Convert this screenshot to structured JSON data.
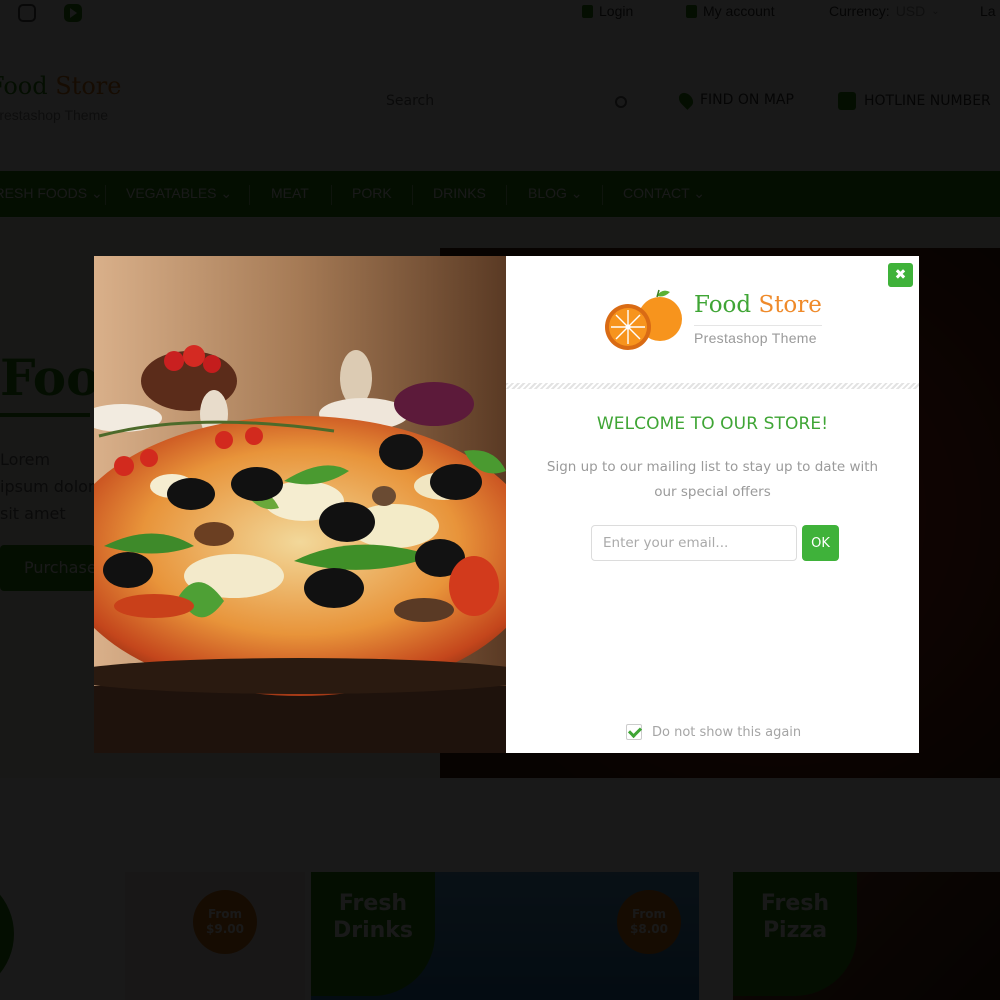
{
  "topbar": {
    "social": [
      "instagram-icon",
      "youtube-icon"
    ],
    "login": "Login",
    "my_account": "My account",
    "currency_label": "Currency:",
    "currency_value": "USD",
    "language_partial": "La"
  },
  "header": {
    "logo_title_part1": "Food ",
    "logo_title_part2": "Store",
    "logo_subtitle": "Prestashop Theme",
    "search_placeholder": "Search",
    "location_text": "FIND ON MAP",
    "phone_text": "HOTLINE NUMBER"
  },
  "nav": {
    "items": [
      {
        "label": "Fresh Foods",
        "dropdown": true
      },
      {
        "label": "Vegatables",
        "dropdown": true
      },
      {
        "label": "Meat",
        "dropdown": false
      },
      {
        "label": "Pork",
        "dropdown": false
      },
      {
        "label": "Drinks",
        "dropdown": false
      },
      {
        "label": "Blog",
        "dropdown": true
      },
      {
        "label": "Contact",
        "dropdown": true
      }
    ]
  },
  "hero": {
    "title": "Food",
    "text": "Lorem ipsum dolor sit amet elit. Integer curabitur",
    "button": "Purchase"
  },
  "cards": [
    {
      "title": "",
      "price_label": ""
    },
    {
      "title": "",
      "price_from": "From",
      "price": "$9.00"
    },
    {
      "title_line1": "Fresh",
      "title_line2": "Drinks",
      "price_from": "From",
      "price": "$8.00"
    },
    {
      "title_line1": "Fresh",
      "title_line2": "Pizza"
    }
  ],
  "modal": {
    "logo_title_part1": "Food ",
    "logo_title_part2": "Store",
    "logo_subtitle": "Prestashop Theme",
    "heading": "WELCOME TO OUR STORE!",
    "description": "Sign up to our mailing list to stay up to date with our special offers",
    "email_value": "",
    "email_placeholder": "Enter your email...",
    "ok_label": "OK",
    "close_label": "✖",
    "dont_show_label": "Do not show this again",
    "dont_show_checked": true
  },
  "colors": {
    "brand_green": "#3fb23a",
    "brand_orange": "#ef8a2a",
    "nav_green": "#2e8b10",
    "overlay": "rgba(0,0,0,0.9)"
  }
}
